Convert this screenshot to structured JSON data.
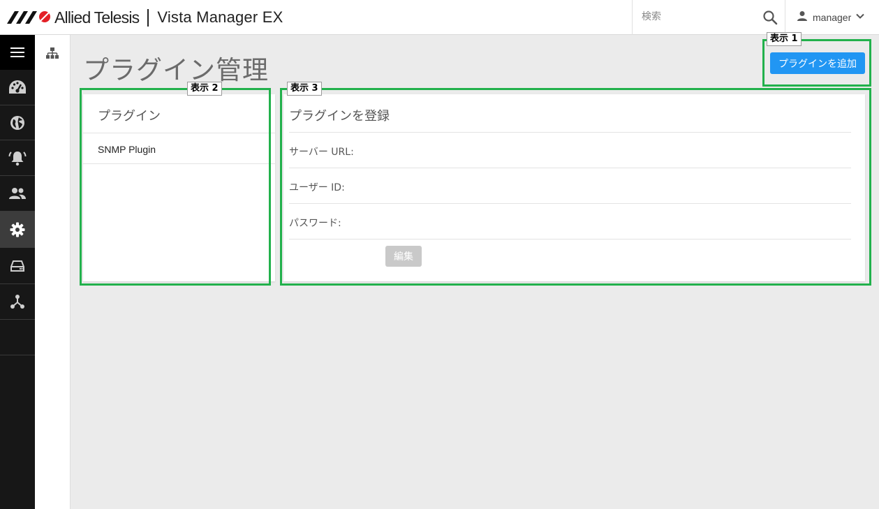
{
  "header": {
    "brand": "Allied Telesis",
    "product": "Vista Manager EX",
    "search_placeholder": "検索",
    "user_name": "manager"
  },
  "sidebar": {
    "items": [
      {
        "icon": "menu-icon"
      },
      {
        "icon": "dashboard-icon"
      },
      {
        "icon": "globe-icon"
      },
      {
        "icon": "alarm-icon"
      },
      {
        "icon": "users-icon"
      },
      {
        "icon": "gear-icon",
        "active": true
      },
      {
        "icon": "storage-icon"
      },
      {
        "icon": "network-icon"
      }
    ]
  },
  "page": {
    "title": "プラグイン管理",
    "add_button": "プラグインを追加"
  },
  "plugins_panel": {
    "title": "プラグイン",
    "items": [
      "SNMP Plugin"
    ]
  },
  "register_panel": {
    "title": "プラグインを登録",
    "fields": [
      "サーバー URL:",
      "ユーザー ID:",
      "パスワード:"
    ],
    "edit_button": "編集"
  },
  "callouts": [
    "表示 1",
    "表示 2",
    "表示 3"
  ],
  "colors": {
    "accent": "#2196f3",
    "sidebar_bg": "#171717",
    "callout_border": "#22b14c",
    "disabled_button": "#c9c9c9"
  }
}
